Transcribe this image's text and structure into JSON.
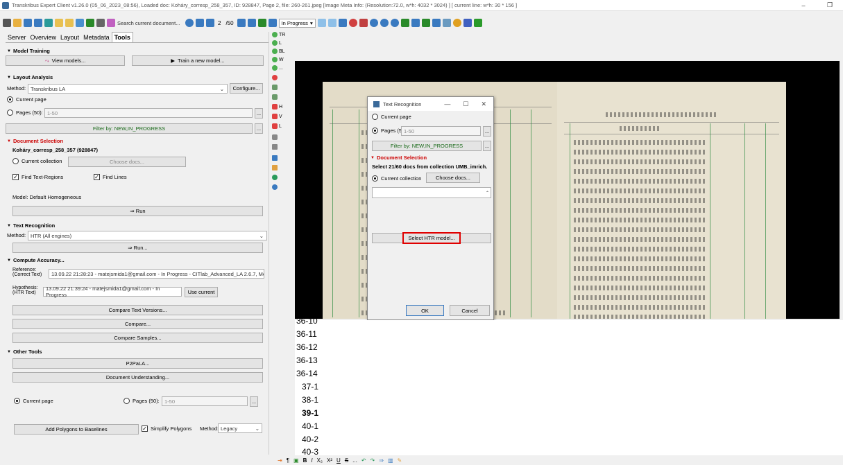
{
  "window": {
    "title": "Transkribus Expert Client v1.26.0 (05_06_2023_08:56), Loaded doc: Koháry_corresp_258_357, ID: 928847, Page 2, file: 260-261.jpeg [Image Meta Info: (Resolution:72.0, w*h: 4032 * 3024) ] [ current line: w*h: 30 * 156 ]",
    "minimize": "–",
    "restore": "❐"
  },
  "toolbar": {
    "search_label": "Search current document...",
    "page_current": "2",
    "page_total": "/50",
    "status_select": "In Progress"
  },
  "tabs": [
    "Server",
    "Overview",
    "Layout",
    "Metadata",
    "Tools"
  ],
  "model_training": {
    "header": "Model Training",
    "view_models": "View models...",
    "train_new": "Train a new model..."
  },
  "layout_analysis": {
    "header": "Layout Analysis",
    "method_label": "Method:",
    "method_value": "Transkribus LA",
    "configure": "Configure...",
    "current_page": "Current page",
    "pages_label": "Pages (50):",
    "pages_value": "1-50",
    "more": "...",
    "filter": "Filter by: NEW,IN_PROGRESS",
    "doc_selection_header": "Document Selection",
    "doc_name": "Koháry_corresp_258_357 (928847)",
    "current_collection": "Current collection",
    "choose_docs": "Choose docs...",
    "find_regions": "Find Text-Regions",
    "find_lines": "Find Lines",
    "model": "Model: Default Homogeneous",
    "run": "⇒ Run"
  },
  "text_recognition": {
    "header": "Text Recognition",
    "method_label": "Method:",
    "method_value": "HTR (All engines)",
    "run": "⇒ Run..."
  },
  "compute_accuracy": {
    "header": "Compute Accuracy...",
    "reference_label": "Reference:",
    "reference_sub": "(Correct Text)",
    "reference_value": "13.09.22 21:28:23 - matejsmida1@gmail.com - In Progress - CITlab_Advanced_LA 2.6.7, Moc",
    "hypothesis_label": "Hypothesis:",
    "hypothesis_sub": "(HTR Text)",
    "hypothesis_value": "13.09.22 21:39:24 - matejsmida1@gmail.com - In Progress",
    "use_current": "Use current",
    "compare_versions": "Compare Text Versions...",
    "compare": "Compare...",
    "compare_samples": "Compare Samples..."
  },
  "other_tools": {
    "header": "Other Tools",
    "p2pala": "P2PaLA...",
    "doc_understanding": "Document Understanding...",
    "current_page": "Current page",
    "pages_label": "Pages (50):",
    "pages_value": "1-50",
    "add_polygons": "Add Polygons to Baselines",
    "simplify": "Simplify Polygons",
    "method_label": "Method:",
    "method_value": "Legacy"
  },
  "side_icons": [
    "TR",
    "L",
    "BL",
    "W",
    "..."
  ],
  "side_icons2": [
    "H",
    "V",
    "L"
  ],
  "dialog": {
    "title": "Text Recognition",
    "current_page": "Current page",
    "pages_label": "Pages (50):",
    "pages_value": "1-50",
    "filter": "Filter by: NEW,IN_PROGRESS",
    "doc_selection_header": "Document Selection",
    "select_info": "Select 21/60 docs from collection UMB_imrich.",
    "current_collection": "Current collection",
    "choose_docs": "Choose docs...",
    "select_htr": "Select HTR model...",
    "ok": "OK",
    "cancel": "Cancel"
  },
  "lines": [
    "36-10",
    "36-11",
    "36-12",
    "36-13",
    "36-14",
    "37-1",
    "38-1",
    "39-1",
    "40-1",
    "40-2",
    "40-3"
  ],
  "bottom_toolbar": [
    "B",
    "I",
    "X₂",
    "X²",
    "U",
    "S",
    "..."
  ],
  "colors": {
    "accent_red": "#c00000",
    "highlight_border": "#e00000",
    "filter_green": "#1a6a1a",
    "layout_green": "#2b8a3e"
  }
}
